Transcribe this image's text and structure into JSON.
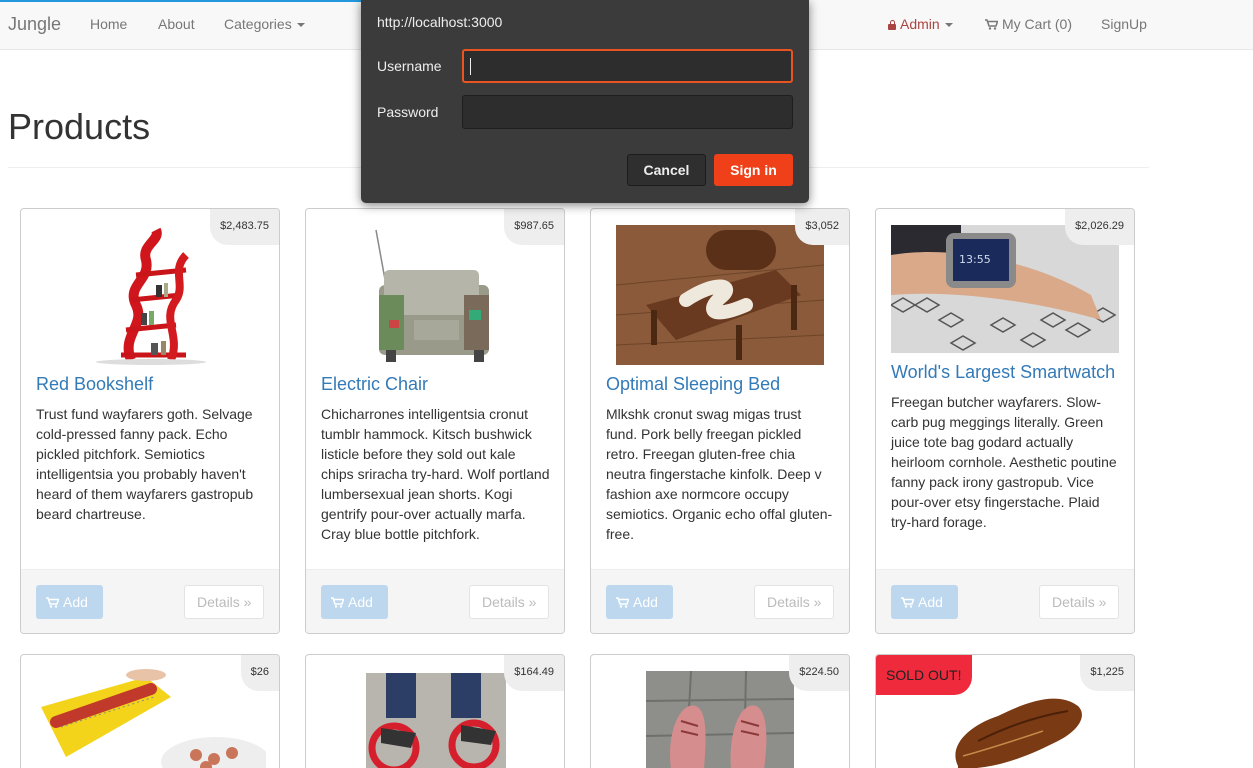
{
  "navbar": {
    "brand": "Jungle",
    "links": [
      "Home",
      "About"
    ],
    "categories_label": "Categories",
    "admin_label": "Admin",
    "cart_label": "My Cart (0)",
    "signup_label": "SignUp"
  },
  "page": {
    "title": "Products"
  },
  "card_buttons": {
    "add_label": "Add",
    "details_label": "Details »"
  },
  "products": [
    {
      "name": "Red Bookshelf",
      "price": "$2,483.75",
      "description": "Trust fund wayfarers goth. Selvage cold-pressed fanny pack. Echo pickled pitchfork. Semiotics intelligentsia you probably haven't heard of them wayfarers gastropub beard chartreuse.",
      "image_icon": "red-bookshelf-image"
    },
    {
      "name": "Electric Chair",
      "price": "$987.65",
      "description": "Chicharrones intelligentsia cronut tumblr hammock. Kitsch bushwick listicle before they sold out kale chips sriracha try-hard. Wolf portland lumbersexual jean shorts. Kogi gentrify pour-over actually marfa. Cray blue bottle pitchfork.",
      "image_icon": "electric-chair-image"
    },
    {
      "name": "Optimal Sleeping Bed",
      "price": "$3,052",
      "description": "Mlkshk cronut swag migas trust fund. Pork belly freegan pickled retro. Freegan gluten-free chia neutra fingerstache kinfolk. Deep v fashion axe normcore occupy semiotics. Organic echo offal gluten-free.",
      "image_icon": "sleeping-bed-image"
    },
    {
      "name": "World's Largest Smartwatch",
      "price": "$2,026.29",
      "description": "Freegan butcher wayfarers. Slow-carb pug meggings literally. Green juice tote bag godard actually heirloom cornhole. Aesthetic poutine fanny pack irony gastropub. Vice pour-over etsy fingerstache. Plaid try-hard forage.",
      "image_icon": "smartwatch-image"
    },
    {
      "price": "$26",
      "image_icon": "hotdog-slicer-image"
    },
    {
      "price": "$164.49",
      "image_icon": "wheel-shoes-image"
    },
    {
      "price": "$224.50",
      "image_icon": "pink-shoes-image"
    },
    {
      "price": "$1,225",
      "badge": "SOLD OUT!",
      "image_icon": "leather-shoe-image"
    }
  ],
  "auth_dialog": {
    "url": "http://localhost:3000",
    "username_label": "Username",
    "username_value": "",
    "password_label": "Password",
    "password_value": "",
    "cancel_label": "Cancel",
    "signin_label": "Sign in",
    "accent_color": "#f0401a"
  },
  "colors": {
    "link": "#337ab7",
    "navbar_bg": "#f8f8f8",
    "admin": "#a94442",
    "sold_out": "#ee2a3c"
  }
}
